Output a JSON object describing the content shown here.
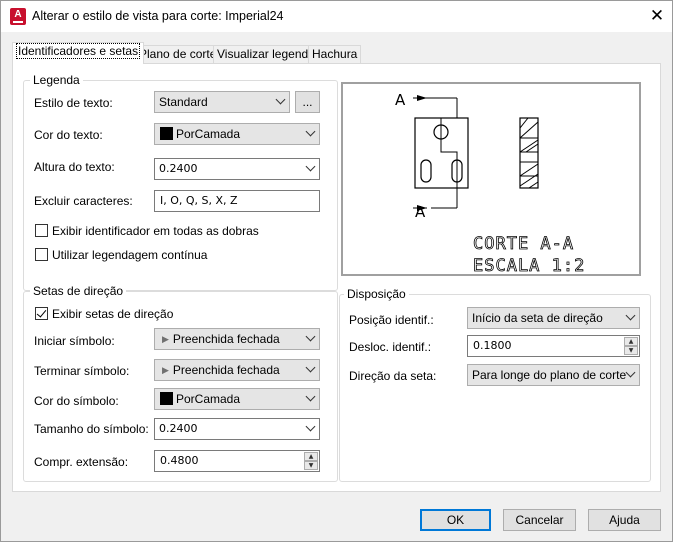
{
  "window": {
    "title": "Alterar o estilo de vista para corte: Imperial24",
    "app_icon_letter": "A",
    "close_symbol": "✕"
  },
  "tabs": [
    {
      "label": "Identificadores e setas",
      "active": true
    },
    {
      "label": "Plano de corte",
      "active": false
    },
    {
      "label": "Visualizar legenda",
      "active": false
    },
    {
      "label": "Hachura",
      "active": false
    }
  ],
  "legenda": {
    "group_title": "Legenda",
    "estilo_texto": {
      "label": "Estilo de texto:",
      "value": "Standard",
      "browse_label": "..."
    },
    "cor_texto": {
      "label": "Cor do texto:",
      "value": "PorCamada",
      "swatch_color": "#000000"
    },
    "altura_texto": {
      "label": "Altura do texto:",
      "value": "0.2400"
    },
    "excluir_caracteres": {
      "label": "Excluir caracteres:",
      "value": "I, O, Q, S, X, Z"
    },
    "exibir_identificador": {
      "label": "Exibir identificador em todas as dobras",
      "checked": false
    },
    "legendagem_continua": {
      "label": "Utilizar legendagem contínua",
      "checked": false
    }
  },
  "setas": {
    "group_title": "Setas de direção",
    "exibir_setas": {
      "label": "Exibir setas de direção",
      "checked": true
    },
    "iniciar_simbolo": {
      "label": "Iniciar símbolo:",
      "value": "Preenchida fechada"
    },
    "terminar_simbolo": {
      "label": "Terminar símbolo:",
      "value": "Preenchida fechada"
    },
    "cor_simbolo": {
      "label": "Cor do símbolo:",
      "value": "PorCamada",
      "swatch_color": "#000000"
    },
    "tamanho_simbolo": {
      "label": "Tamanho do símbolo:",
      "value": "0.2400"
    },
    "compr_extensao": {
      "label": "Compr. extensão:",
      "value": "0.4800"
    }
  },
  "preview": {
    "label_top": "A",
    "label_bottom": "A",
    "caption_line1": "CORTE A-A",
    "caption_line2": "ESCALA 1:2"
  },
  "disposicao": {
    "group_title": "Disposição",
    "posicao_identif": {
      "label": "Posição identif.:",
      "value": "Início da seta de direção"
    },
    "desloc_identif": {
      "label": "Desloc. identif.:",
      "value": "0.1800"
    },
    "direcao_seta": {
      "label": "Direção da seta:",
      "value": "Para longe do plano de corte"
    }
  },
  "footer": {
    "ok": "OK",
    "cancel": "Cancelar",
    "help": "Ajuda"
  }
}
